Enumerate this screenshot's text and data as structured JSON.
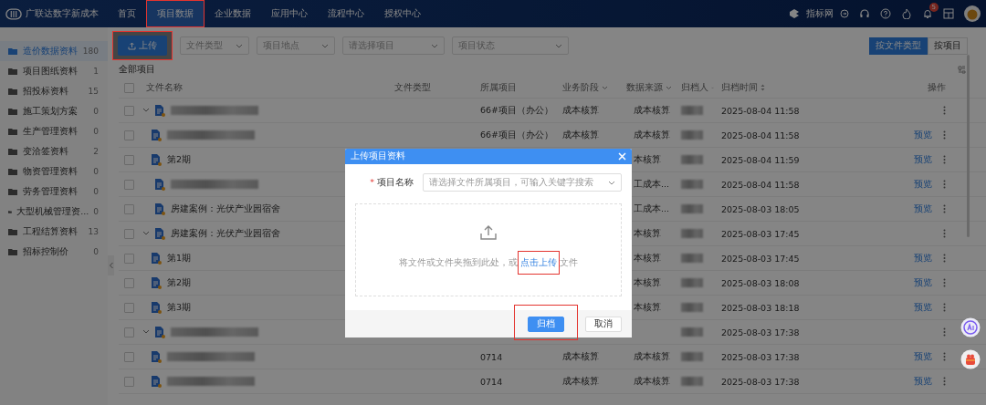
{
  "nav": {
    "brand": "广联达数字新成本",
    "tabs": [
      {
        "label": "首页",
        "selected": false,
        "highlighted": false
      },
      {
        "label": "项目数据",
        "selected": true,
        "highlighted": true
      },
      {
        "label": "企业数据",
        "selected": false,
        "highlighted": false
      },
      {
        "label": "应用中心",
        "selected": false,
        "highlighted": false
      },
      {
        "label": "流程中心",
        "selected": false,
        "highlighted": false
      },
      {
        "label": "授权中心",
        "selected": false,
        "highlighted": false
      }
    ],
    "link": "指标网",
    "badge": "5"
  },
  "sidebar": {
    "items": [
      {
        "label": "造价数据资料",
        "count": "180",
        "selected": true
      },
      {
        "label": "项目图纸资料",
        "count": "1",
        "selected": false
      },
      {
        "label": "招投标资料",
        "count": "15",
        "selected": false
      },
      {
        "label": "施工策划方案",
        "count": "0",
        "selected": false
      },
      {
        "label": "生产管理资料",
        "count": "0",
        "selected": false
      },
      {
        "label": "变洽签资料",
        "count": "2",
        "selected": false
      },
      {
        "label": "物资管理资料",
        "count": "0",
        "selected": false
      },
      {
        "label": "劳务管理资料",
        "count": "0",
        "selected": false
      },
      {
        "label": "大型机械管理资...",
        "count": "0",
        "selected": false
      },
      {
        "label": "工程结算资料",
        "count": "13",
        "selected": false
      },
      {
        "label": "招标控制价",
        "count": "0",
        "selected": false
      }
    ]
  },
  "toolbar": {
    "upload": {
      "label": "上传",
      "highlighted": true
    },
    "filters": [
      {
        "placeholder": "文件类型"
      },
      {
        "placeholder": "项目地点"
      },
      {
        "placeholder": "请选择项目"
      },
      {
        "placeholder": "项目状态"
      }
    ],
    "view_toggle": [
      {
        "label": "按文件类型",
        "selected": true
      },
      {
        "label": "按项目",
        "selected": false
      }
    ]
  },
  "breadcrumb": "全部项目",
  "table": {
    "all_checked": false,
    "columns": [
      {
        "label": "文件名称"
      },
      {
        "label": "文件类型"
      },
      {
        "label": "所属项目"
      },
      {
        "label": "业务阶段",
        "kind": "filter"
      },
      {
        "label": "数据来源",
        "kind": "filter"
      },
      {
        "label": "归档人",
        "kind": "filter"
      },
      {
        "label": "归档时间",
        "kind": "sort"
      },
      {
        "label": "操作"
      }
    ],
    "rows": [
      {
        "checked": false,
        "name_blurred": true,
        "project": "66#项目（办公）",
        "stage": "成本核算",
        "source": "成本核算",
        "time": "2025-08-04 11:58",
        "expanded": true,
        "children": [
          {
            "checked": false,
            "name_blurred": true,
            "project": "66#项目（办公）",
            "stage": "成本核算",
            "source": "成本核算",
            "time": "2025-08-04 11:58",
            "preview": "预览"
          },
          {
            "checked": false,
            "name": "第2期",
            "source": "本核算",
            "time": "2025-08-04 11:59",
            "preview": "预览"
          }
        ]
      },
      {
        "checked": false,
        "name_blurred": true,
        "source": "工成本...",
        "time": "2025-08-04 11:58",
        "preview": "预览"
      },
      {
        "checked": false,
        "name": "房建案例：光伏产业园宿舍",
        "source": "工成本...",
        "time": "2025-08-03 18:05",
        "preview": "预览"
      },
      {
        "checked": false,
        "name": "房建案例：光伏产业园宿舍",
        "source": "本核算",
        "time": "2025-08-03 17:45",
        "expanded": true,
        "children": [
          {
            "checked": false,
            "name": "第1期",
            "source": "本核算",
            "time": "2025-08-03 17:45",
            "preview": "预览"
          },
          {
            "checked": false,
            "name": "第2期",
            "source": "本核算",
            "time": "2025-08-03 18:08",
            "preview": "预览"
          },
          {
            "checked": false,
            "name": "第3期",
            "source": "本核算",
            "time": "2025-08-03 18:18",
            "preview": "预览"
          }
        ]
      },
      {
        "checked": false,
        "name_blurred": true,
        "time": "2025-08-03 17:38",
        "expanded": true,
        "children": [
          {
            "checked": false,
            "name_blurred": true,
            "project": "0714",
            "stage": "成本核算",
            "source": "成本核算",
            "time": "2025-08-03 17:38",
            "preview": "预览"
          },
          {
            "checked": false,
            "name_blurred": true,
            "project": "0714",
            "stage": "成本核算",
            "source": "成本核算",
            "time": "2025-08-03 17:38",
            "preview": "预览"
          }
        ]
      }
    ]
  },
  "dialog": {
    "title": "上传项目资料",
    "field": {
      "label": "项目名称",
      "required_mark": "*",
      "placeholder": "请选择文件所属项目，可输入关键字搜索"
    },
    "drop_text": "将文件或文件夹拖到此处，或",
    "link": {
      "label": "点击上传",
      "highlighted": true
    },
    "drop_suffix": "文件",
    "buttons": [
      {
        "label": "归档",
        "kind": "primary",
        "highlighted": true
      },
      {
        "label": "取消",
        "kind": "default",
        "highlighted": false
      }
    ]
  }
}
